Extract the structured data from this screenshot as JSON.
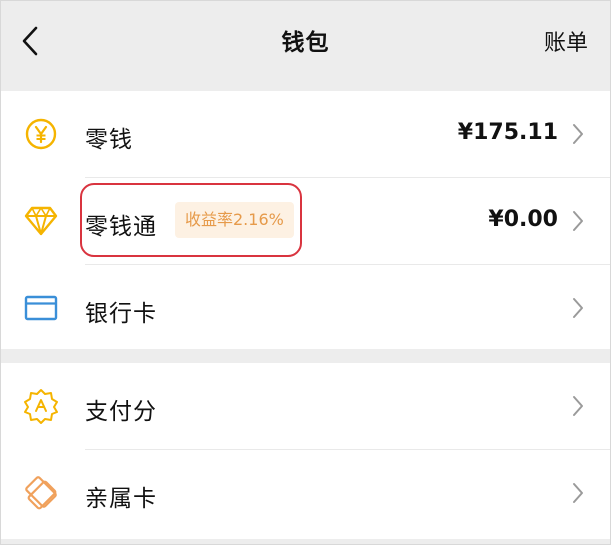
{
  "header": {
    "title": "钱包",
    "right_label": "账单"
  },
  "rows": [
    {
      "label": "零钱",
      "value": "¥175.11",
      "icon": "yuan-coin-icon"
    },
    {
      "label": "零钱通",
      "badge": "收益率2.16%",
      "value": "¥0.00",
      "icon": "diamond-icon"
    },
    {
      "label": "银行卡",
      "icon": "bank-card-icon"
    },
    {
      "label": "支付分",
      "icon": "payscore-badge-icon"
    },
    {
      "label": "亲属卡",
      "icon": "family-card-icon"
    }
  ],
  "colors": {
    "accent": "#f5b400",
    "card_blue": "#3a8fd8",
    "badge_text": "#e69a4a",
    "badge_bg": "#fdf1e3",
    "highlight": "#d9343f"
  }
}
